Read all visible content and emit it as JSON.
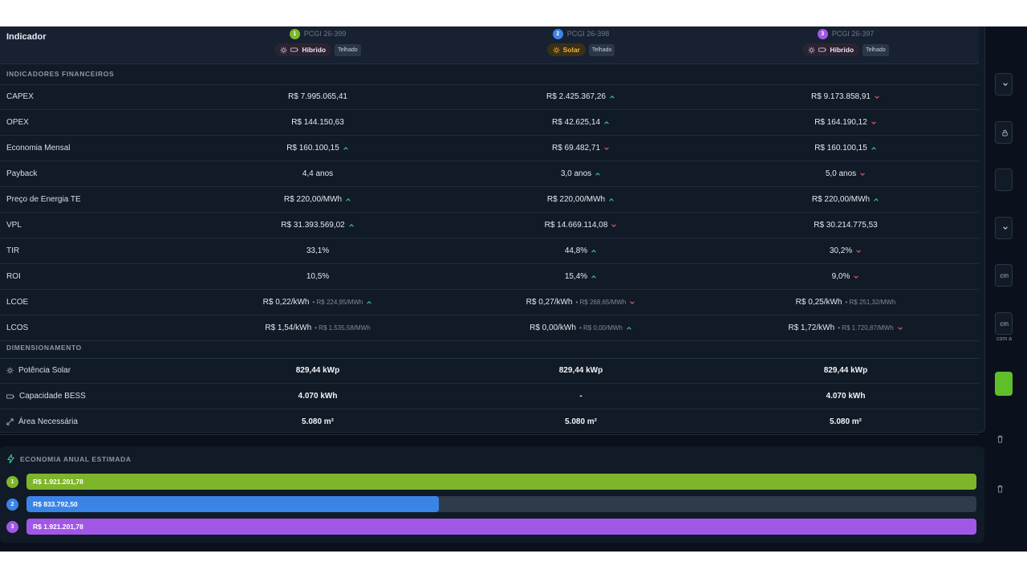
{
  "table": {
    "indicator_label": "Indicador",
    "columns": [
      {
        "num": "1",
        "code": "PCGI 26-399",
        "type": "Híbrido",
        "roof": "Telhado",
        "color": "#7db62a"
      },
      {
        "num": "2",
        "code": "PCGI 26-398",
        "type": "Solar",
        "roof": "Telhado",
        "color": "#3a84e6"
      },
      {
        "num": "3",
        "code": "PCGI 26-397",
        "type": "Híbrido",
        "roof": "Telhado",
        "color": "#a256e6"
      }
    ],
    "sections": {
      "financial": "INDICADORES FINANCEIROS",
      "sizing": "DIMENSIONAMENTO"
    },
    "financial_rows": [
      {
        "label": "CAPEX",
        "cells": [
          {
            "v": "R$ 7.995.065,41",
            "t": ""
          },
          {
            "v": "R$ 2.425.367,26",
            "t": "up"
          },
          {
            "v": "R$ 9.173.858,91",
            "t": "down"
          }
        ]
      },
      {
        "label": "OPEX",
        "cells": [
          {
            "v": "R$ 144.150,63",
            "t": ""
          },
          {
            "v": "R$ 42.625,14",
            "t": "up"
          },
          {
            "v": "R$ 164.190,12",
            "t": "down"
          }
        ]
      },
      {
        "label": "Economia Mensal",
        "cells": [
          {
            "v": "R$ 160.100,15",
            "t": "up"
          },
          {
            "v": "R$ 69.482,71",
            "t": "down"
          },
          {
            "v": "R$ 160.100,15",
            "t": "up"
          }
        ]
      },
      {
        "label": "Payback",
        "cells": [
          {
            "v": "4,4 anos",
            "t": ""
          },
          {
            "v": "3,0 anos",
            "t": "up"
          },
          {
            "v": "5,0 anos",
            "t": "down"
          }
        ]
      },
      {
        "label": "Preço de Energia TE",
        "cells": [
          {
            "v": "R$ 220,00/MWh",
            "t": "up"
          },
          {
            "v": "R$ 220,00/MWh",
            "t": "up"
          },
          {
            "v": "R$ 220,00/MWh",
            "t": "up"
          }
        ]
      },
      {
        "label": "VPL",
        "cells": [
          {
            "v": "R$ 31.393.569,02",
            "t": "up"
          },
          {
            "v": "R$ 14.669.114,08",
            "t": "down"
          },
          {
            "v": "R$ 30.214.775,53",
            "t": ""
          }
        ]
      },
      {
        "label": "TIR",
        "cells": [
          {
            "v": "33,1%",
            "t": ""
          },
          {
            "v": "44,8%",
            "t": "up"
          },
          {
            "v": "30,2%",
            "t": "down"
          }
        ]
      },
      {
        "label": "ROI",
        "cells": [
          {
            "v": "10,5%",
            "t": ""
          },
          {
            "v": "15,4%",
            "t": "up"
          },
          {
            "v": "9,0%",
            "t": "down"
          }
        ]
      },
      {
        "label": "LCOE",
        "cells": [
          {
            "v": "R$ 0,22/kWh",
            "s": "• R$ 224,95/MWh",
            "t": "up"
          },
          {
            "v": "R$ 0,27/kWh",
            "s": "• R$ 268,65/MWh",
            "t": "down"
          },
          {
            "v": "R$ 0,25/kWh",
            "s": "• R$ 251,32/MWh",
            "t": ""
          }
        ]
      },
      {
        "label": "LCOS",
        "cells": [
          {
            "v": "R$ 1,54/kWh",
            "s": "• R$ 1.535,58/MWh",
            "t": ""
          },
          {
            "v": "R$ 0,00/kWh",
            "s": "• R$ 0,00/MWh",
            "t": "up"
          },
          {
            "v": "R$ 1,72/kWh",
            "s": "• R$ 1.720,87/MWh",
            "t": "down"
          }
        ]
      }
    ],
    "sizing_rows": [
      {
        "label": "Potência Solar",
        "icon": "sun-icon",
        "cells": [
          "829,44 kWp",
          "829,44 kWp",
          "829,44 kWp"
        ]
      },
      {
        "label": "Capacidade BESS",
        "icon": "battery-icon",
        "cells": [
          "4.070 kWh",
          "-",
          "4.070 kWh"
        ]
      },
      {
        "label": "Área Necessária",
        "icon": "expand-icon",
        "cells": [
          "5.080 m²",
          "5.080 m²",
          "5.080 m²"
        ]
      }
    ]
  },
  "economy": {
    "title": "ECONOMIA ANUAL ESTIMADA",
    "bars": [
      {
        "num": "1",
        "value": "R$ 1.921.201,78",
        "amount": 1921201.78,
        "color": "#7db62a"
      },
      {
        "num": "2",
        "value": "R$ 833.792,50",
        "amount": 833792.5,
        "color": "#3a84e6"
      },
      {
        "num": "3",
        "value": "R$ 1.921.201,78",
        "amount": 1921201.78,
        "color": "#a256e6"
      }
    ]
  },
  "side": {
    "unit1": "cm",
    "unit2": "cm",
    "note": "com a"
  },
  "colors": {
    "up": "#36c48a",
    "down": "#e25563",
    "solar_pill_bg": "#3a2f17",
    "solar_pill_text": "#f0b33d",
    "hybrid_pill_bg": "#2c2331"
  }
}
